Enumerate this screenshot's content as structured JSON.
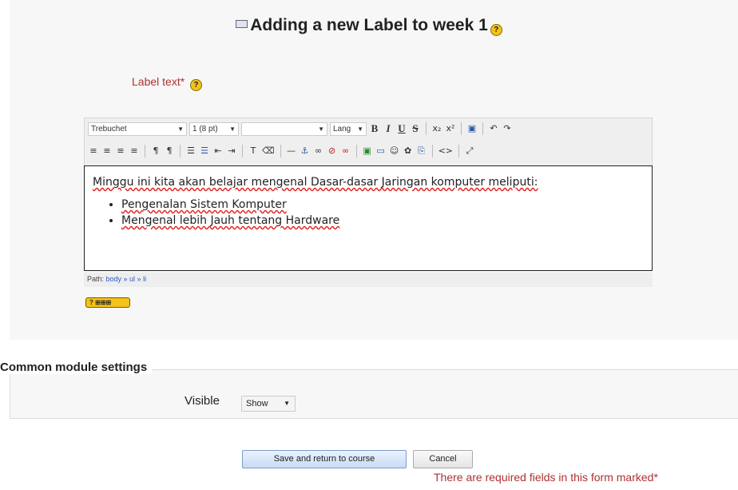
{
  "page": {
    "title": "Adding a new Label to week 1",
    "help_glyph": "?",
    "module_icon": "label-module-icon"
  },
  "form": {
    "label_text": "Label text*",
    "help_glyph": "?"
  },
  "editor": {
    "font_select": "Trebuchet",
    "size_select": "1 (8 pt)",
    "format_select": "",
    "lang_select": "Lang",
    "toolbar_row1": [
      "B",
      "I",
      "U",
      "S",
      "x₂",
      "x²",
      "▣",
      "↶",
      "↷"
    ],
    "toolbar_row2": [
      "≡",
      "≡",
      "≡",
      "≡",
      "¶",
      "¶",
      "☰",
      "☰",
      "⇤",
      "⇥",
      "T",
      "⌫",
      "—",
      "⚓",
      "∞",
      "⊘",
      "∞",
      "▣",
      "▭",
      "☺",
      "✿",
      "⎘",
      "<>",
      "⤢"
    ],
    "content": {
      "paragraph": "Minggu ini kita akan belajar mengenal Dasar-dasar Jaringan komputer meliputi:",
      "items": [
        "Pengenalan Sistem Komputer",
        "Mengenal lebih Jauh tentang Hardware"
      ]
    },
    "path_label": "Path:",
    "path_value": "body » ul » li",
    "help_badge": "? ⊞⊞⊞"
  },
  "common_settings": {
    "legend": "Common module settings",
    "visible_label": "Visible",
    "visible_value": "Show"
  },
  "buttons": {
    "save": "Save and return to course",
    "cancel": "Cancel"
  },
  "required_note": "There are required fields in this form marked*",
  "colors": {
    "required_red": "#b03030",
    "help_yellow": "#f3c21b",
    "band_gray": "#f7f7f7"
  }
}
